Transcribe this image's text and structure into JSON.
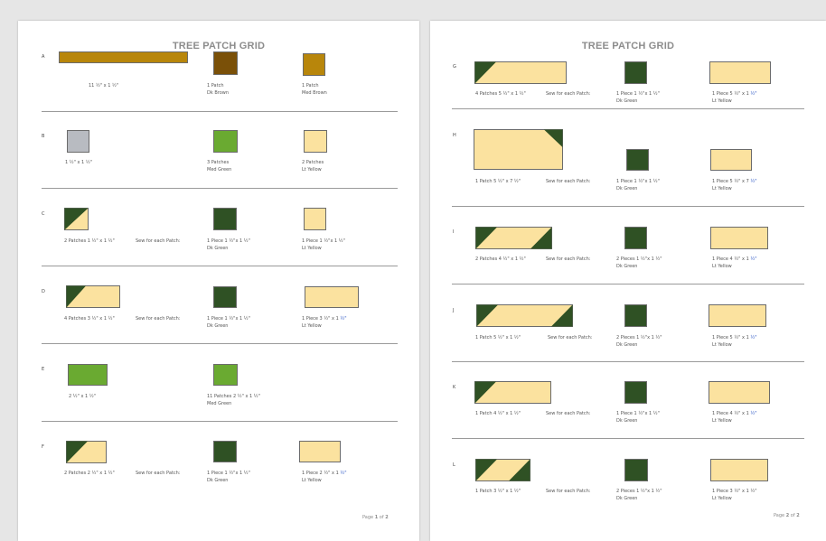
{
  "colors": {
    "dk_brown": "#7a5008",
    "med_brown": "#b8860b",
    "gold_strip": "#b8860b",
    "gray": "#b8bbc1",
    "med_green": "#6aaa31",
    "dk_green": "#2f5124",
    "lt_yellow": "#fbe29f"
  },
  "page1": {
    "title": "TREE PATCH GRID",
    "page_label": "Page",
    "page_num": "1",
    "page_of": "of",
    "page_total": "2",
    "rows": [
      {
        "letter": "A",
        "cap1": "11 ½\" x 1 ½\"",
        "cap2": "1 Patch",
        "cap2b": "Dk Brown",
        "cap3": "1 Patch",
        "cap3b": "Med Brown",
        "sew": ""
      },
      {
        "letter": "B",
        "cap1": "1 ½\" x 1 ½\"",
        "cap2": "3 Patches",
        "cap2b": "Med Green",
        "cap3": "2 Patches",
        "cap3b": "Lt Yellow",
        "sew": ""
      },
      {
        "letter": "C",
        "cap1": "2 Patches 1 ½\" x 1 ½\"",
        "sew": "Sew for each Patch:",
        "cap2": "1 Piece 1 ½\"x 1 ½\"",
        "cap2b": "Dk Green",
        "cap3": "1 Piece 1 ½\"x 1 ½\"",
        "cap3b": "Lt Yellow"
      },
      {
        "letter": "D",
        "cap1": "4 Patches 3 ½\" x 1 ½\"",
        "sew": "Sew for each Patch:",
        "cap2": "1 Piece 1 ½\"x 1 ½\"",
        "cap2b": "Dk Green",
        "cap3": "1 Piece 3 ½\" x 1 ",
        "cap3u": "½\"",
        "cap3b": "Lt Yellow"
      },
      {
        "letter": "E",
        "cap1": "2 ½\" x 1 ½\"",
        "sew": "",
        "cap2": "11 Patches 2 ½\" x 1 ½\"",
        "cap2b": "Med Green",
        "cap3": "",
        "cap3b": ""
      },
      {
        "letter": "F",
        "cap1": "2 Patches 2 ½\" x 1 ½\"",
        "sew": "Sew for each Patch:",
        "cap2": "1 Piece 1 ½\"x 1 ½\"",
        "cap2b": "Dk Green",
        "cap3": "1 Piece 2 ½\" x 1 ",
        "cap3u": "½\"",
        "cap3b": "Lt Yellow"
      }
    ]
  },
  "page2": {
    "title": "TREE PATCH GRID",
    "page_label": "Page",
    "page_num": "2",
    "page_of": "of",
    "page_total": "2",
    "rows": [
      {
        "letter": "G",
        "cap1": "4 Patches 5 ½\" x 1 ½\"",
        "sew": "Sew for each Patch:",
        "cap2": "1 Piece 1 ½\"x 1 ½\"",
        "cap2b": "Dk Green",
        "cap3": "1 Piece 5 ½\" x 1 ",
        "cap3u": "½\"",
        "cap3b": "Lt Yellow"
      },
      {
        "letter": "H",
        "cap1": "1 Patch 5 ½\" x 7 ½\"",
        "sew": "Sew for each Patch:",
        "cap2": "1 Piece 1 ½\"x 1 ½\"",
        "cap2b": "Dk Green",
        "cap3": "1 Piece 5 ½\" x 7 ",
        "cap3u": "½\"",
        "cap3b": "Lt Yellow"
      },
      {
        "letter": "I",
        "cap1": "2 Patches 4 ½\" x 1 ½\"",
        "sew": "Sew for each Patch:",
        "cap2": "2 Pieces 1 ½\"x 1 ½\"",
        "cap2b": "Dk Green",
        "cap3": "1 Piece 4 ½\" x 1 ",
        "cap3u": "½\"",
        "cap3b": "Lt Yellow"
      },
      {
        "letter": "J",
        "cap1": "1 Patch 5 ½\" x 1 ½\"",
        "sew": "Sew for each Patch:",
        "cap2": "2 Pieces 1 ½\"x 1 ½\"",
        "cap2b": "Dk Green",
        "cap3": "1 Piece 5 ½\" x 1 ",
        "cap3u": "½\"",
        "cap3b": "Lt Yellow"
      },
      {
        "letter": "K",
        "cap1": "1 Patch 4 ½\" x 1 ½\"",
        "sew": "Sew for each Patch:",
        "cap2": "1 Piece 1 ½\"x 1 ½\"",
        "cap2b": "Dk Green",
        "cap3": "1 Piece 4 ½\" x 1 ",
        "cap3u": "½\"",
        "cap3b": "Lt Yellow"
      },
      {
        "letter": "L",
        "cap1": "1 Patch 3 ½\" x 1 ½\"",
        "sew": "Sew for each Patch:",
        "cap2": "2 Pieces 1 ½\"x 1 ½\"",
        "cap2b": "Dk Green",
        "cap3": "1 Piece 3 ½\" x 1 ½\"",
        "cap3b": "Lt Yellow"
      }
    ]
  }
}
